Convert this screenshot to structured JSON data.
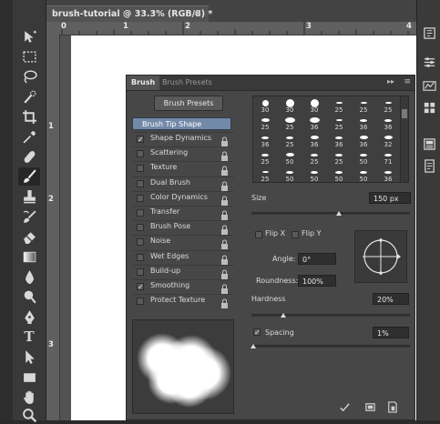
{
  "document": {
    "tab_title": "brush-tutorial @ 33.3% (RGB/8) *",
    "tab_close": "×",
    "ruler_top_labels": [
      "0",
      "1",
      "2",
      "3",
      "4"
    ],
    "ruler_left_labels": [
      "1",
      "2",
      "3"
    ]
  },
  "toolbar": {
    "tools": [
      "move-tool",
      "marquee-tool",
      "lasso-tool",
      "quick-selection-tool",
      "crop-tool",
      "eyedropper-tool",
      "spot-healing-tool",
      "brush-tool",
      "clone-stamp-tool",
      "history-brush-tool",
      "eraser-tool",
      "gradient-tool",
      "blur-tool",
      "dodge-tool",
      "pen-tool",
      "type-tool",
      "path-selection-tool",
      "rectangle-tool",
      "hand-tool",
      "zoom-tool"
    ],
    "type_tool_glyph": "T",
    "active": "brush-tool"
  },
  "dock": {
    "buttons": [
      "history-icon",
      "properties-icon",
      "adjustments-icon",
      "swatches-icon",
      "layers-icon",
      "notes-icon"
    ]
  },
  "brush_panel": {
    "tabs": [
      "Brush",
      "Brush Presets"
    ],
    "active_tab": "Brush",
    "collapse_glyph": "▸▸",
    "menu_glyph": "≡",
    "presets_button": "Brush Presets",
    "tip_shape_header": "Brush Tip Shape",
    "options": [
      {
        "label": "Shape Dynamics",
        "checked": true,
        "check_glyph": "✓"
      },
      {
        "label": "Scattering",
        "checked": false
      },
      {
        "label": "Texture",
        "checked": false
      },
      {
        "label": "Dual Brush",
        "checked": false
      },
      {
        "label": "Color Dynamics",
        "checked": false
      },
      {
        "label": "Transfer",
        "checked": false
      },
      {
        "label": "Brush Pose",
        "checked": false
      },
      {
        "label": "Noise",
        "checked": false
      },
      {
        "label": "Wet Edges",
        "checked": false
      },
      {
        "label": "Build-up",
        "checked": false
      },
      {
        "label": "Smoothing",
        "checked": true,
        "check_glyph": "✓"
      },
      {
        "label": "Protect Texture",
        "checked": false
      }
    ],
    "tip_sizes": [
      [
        "30",
        "30",
        "30",
        "25",
        "25",
        "25"
      ],
      [
        "25",
        "25",
        "36",
        "25",
        "36",
        "36"
      ],
      [
        "36",
        "25",
        "36",
        "36",
        "36",
        "32"
      ],
      [
        "25",
        "50",
        "25",
        "25",
        "50",
        "71"
      ],
      [
        "25",
        "50",
        "50",
        "50",
        "50",
        "36"
      ]
    ],
    "size_label": "Size",
    "size_value": "150 px",
    "size_slider_level": 0.55,
    "flip_x_label": "Flip X",
    "flip_y_label": "Flip Y",
    "angle_label": "Angle:",
    "angle_value": "0°",
    "roundness_label": "Roundness:",
    "roundness_value": "100%",
    "hardness_label": "Hardness",
    "hardness_value": "20%",
    "hardness_slider_level": 0.2,
    "spacing_label": "Spacing",
    "spacing_checked": true,
    "spacing_check_glyph": "✓",
    "spacing_value": "1%",
    "spacing_slider_level": 0.01
  }
}
